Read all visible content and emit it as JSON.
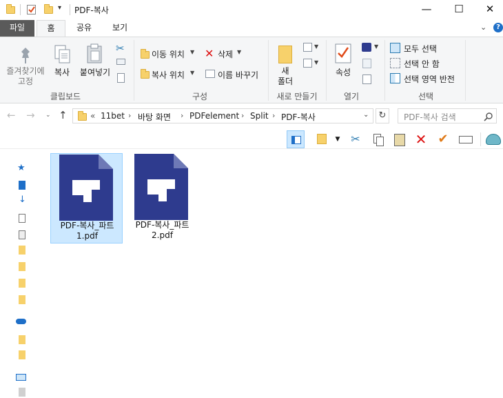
{
  "window": {
    "title": "PDF-복사"
  },
  "tabs": [
    "파일",
    "홈",
    "공유",
    "보기"
  ],
  "ribbon": {
    "clipboard": {
      "pin": "즐겨찾기에\n고정",
      "copy": "복사",
      "paste": "붙여넣기",
      "group": "클립보드"
    },
    "organize": {
      "move_to": "이동 위치",
      "copy_to": "복사 위치",
      "delete": "삭제",
      "rename": "이름 바꾸기",
      "group": "구성"
    },
    "new": {
      "new_folder": "새\n폴더",
      "group": "새로 만들기"
    },
    "open": {
      "properties": "속성",
      "group": "열기"
    },
    "select": {
      "select_all": "모두 선택",
      "select_none": "선택 안 함",
      "invert": "선택 영역 반전",
      "group": "선택"
    }
  },
  "address": {
    "overflow": "«",
    "crumbs": [
      "11bet",
      "바탕 화면",
      "PDFelement",
      "Split",
      "PDF-복사"
    ],
    "search_placeholder": "PDF-복사 검색"
  },
  "files": [
    {
      "name": "PDF-복사_파트\n1.pdf",
      "selected": true
    },
    {
      "name": "PDF-복사_파트\n2.pdf",
      "selected": false
    }
  ],
  "colors": {
    "pdf_icon": "#2e3b8e",
    "selection": "#cce8ff",
    "file_tab": "#5a5a5a",
    "help": "#1e6fc8"
  }
}
